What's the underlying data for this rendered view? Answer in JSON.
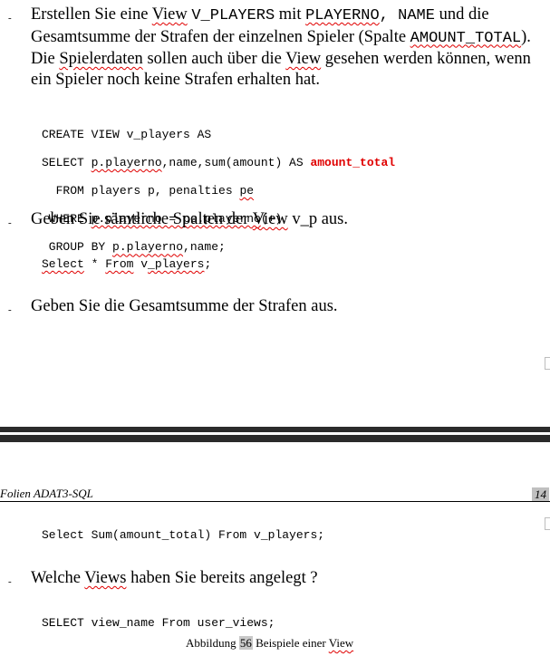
{
  "task1": {
    "bullet": "-",
    "t1": "Erstellen Sie eine ",
    "view_word": "View",
    "t2": " ",
    "view_name": "V_PLAYERS",
    "t3": " mit ",
    "col1": "PLAYERNO",
    "col_sep": ", NAME",
    "t4": " und die",
    "line2a": "Gesamtsumme der Strafen der einzelnen Spieler (Spalte ",
    "col_amount": "AMOUNT_TOTAL",
    "line2b": ").",
    "line3a": "Die ",
    "line3_word": "Spielerdaten",
    "line3b": " sollen auch über die ",
    "line3_view": "View",
    "line3c": " gesehen werden können, wenn",
    "line4": "ein Spieler noch keine Strafen erhalten hat."
  },
  "code1": {
    "l1": "CREATE VIEW v_players AS",
    "l2a": "SELECT ",
    "l2_sq": "p.playerno",
    "l2b": ",name,sum(amount) AS ",
    "l2_red": "amount_total",
    "l3a": "  FROM players p, penalties ",
    "l3_sq": "pe",
    "l4a": " WHERE ",
    "l4_sq": "p.playerno = pe.playerno",
    "l4b": "(+)",
    "l5a": " GROUP BY ",
    "l5_sq": "p.playerno",
    "l5b": ",name;"
  },
  "task2": {
    "bullet": "-",
    "a": "Geben Sie sämtliche Spalten der ",
    "view_word": "View",
    "b": " v_p aus."
  },
  "code2": {
    "sq1": "Select",
    "a": " * ",
    "sq2": "From",
    "b": " v",
    "sq3": "_players",
    "c": ";"
  },
  "task3": {
    "bullet": "-",
    "text": "Geben Sie die Gesamtsumme der Strafen aus."
  },
  "footer": {
    "left": "Folien ADAT3-SQL",
    "page": "14"
  },
  "code3": {
    "line": "Select Sum(amount_total) From v_players;"
  },
  "task4": {
    "bullet": "-",
    "a": "Welche ",
    "views_word": "Views",
    "b": " haben Sie bereits angelegt ?"
  },
  "code4": {
    "line": "SELECT view_name From user_views;"
  },
  "caption": {
    "a": "Abbildung ",
    "num": "56",
    "b": " Beispiele einer ",
    "view_word": "View"
  }
}
